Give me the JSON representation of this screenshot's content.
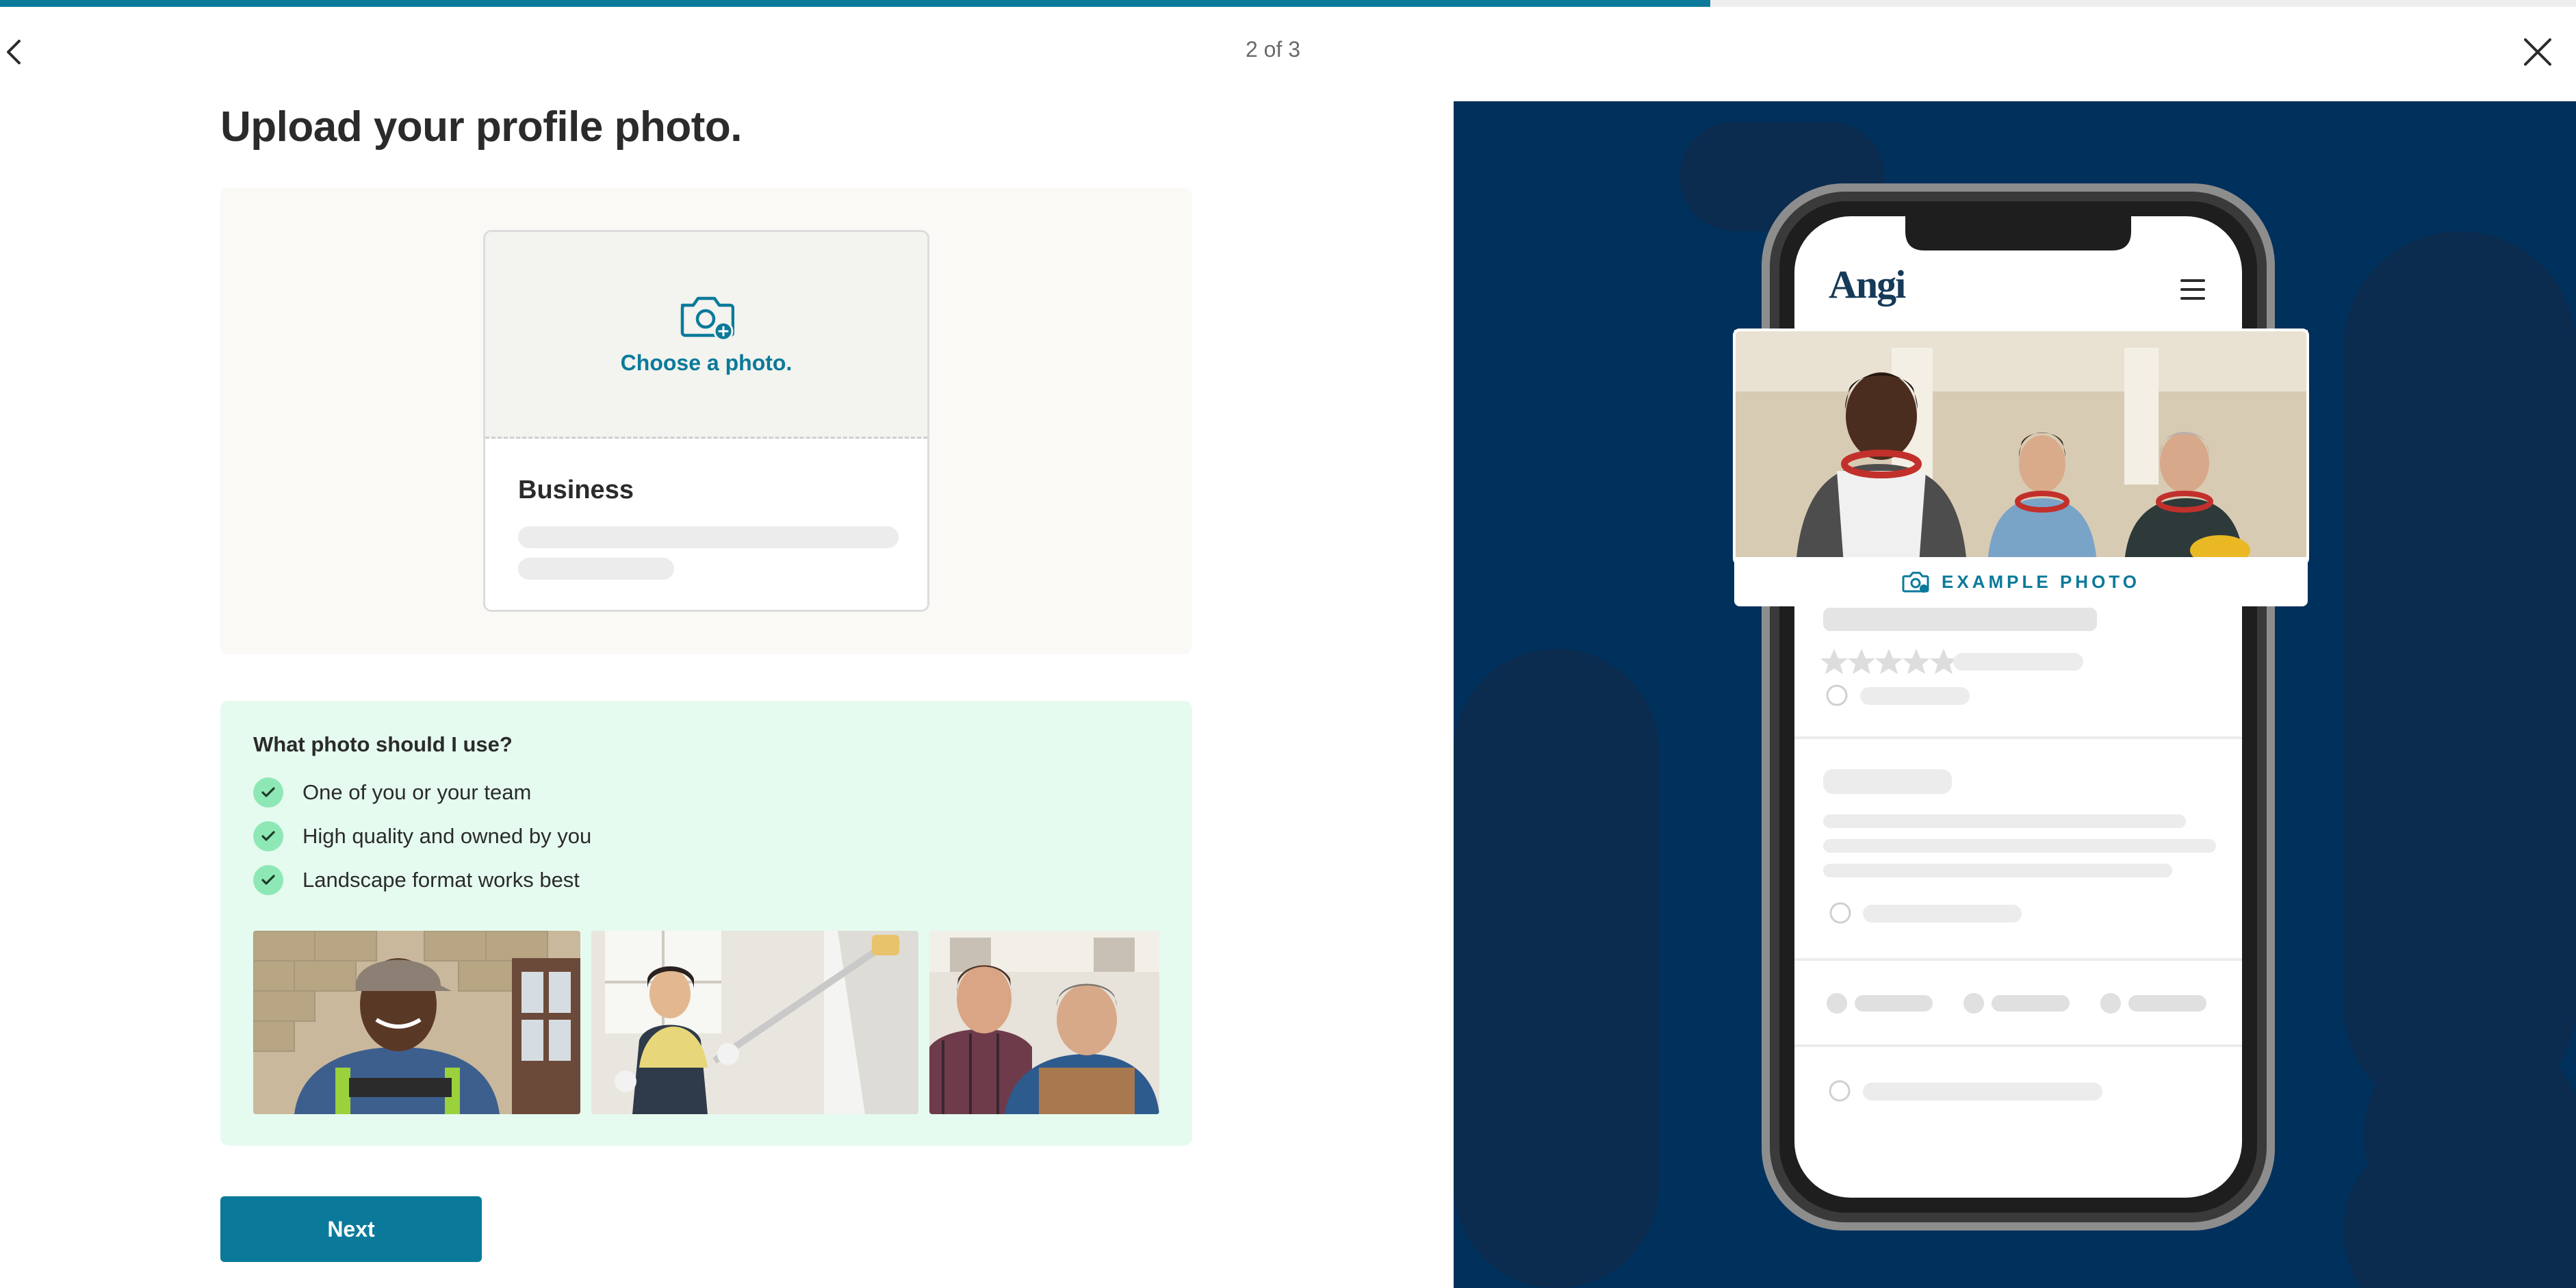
{
  "header": {
    "step": "2 of 3",
    "progress_fraction": 0.664
  },
  "page_title": "Upload your profile photo.",
  "upload": {
    "choose_label": "Choose a photo.",
    "business_label": "Business"
  },
  "tips": {
    "title": "What photo should I use?",
    "items": [
      "One of you or your team",
      "High quality and owned by you",
      "Landscape format works best"
    ]
  },
  "next_label": "Next",
  "promo": {
    "brand": "Angi",
    "example_label": "EXAMPLE PHOTO"
  },
  "colors": {
    "accent": "#0b7a9a",
    "promo_bg": "#00305c",
    "tips_bg": "#e5fbef",
    "check_bg": "#8ee8b6"
  }
}
